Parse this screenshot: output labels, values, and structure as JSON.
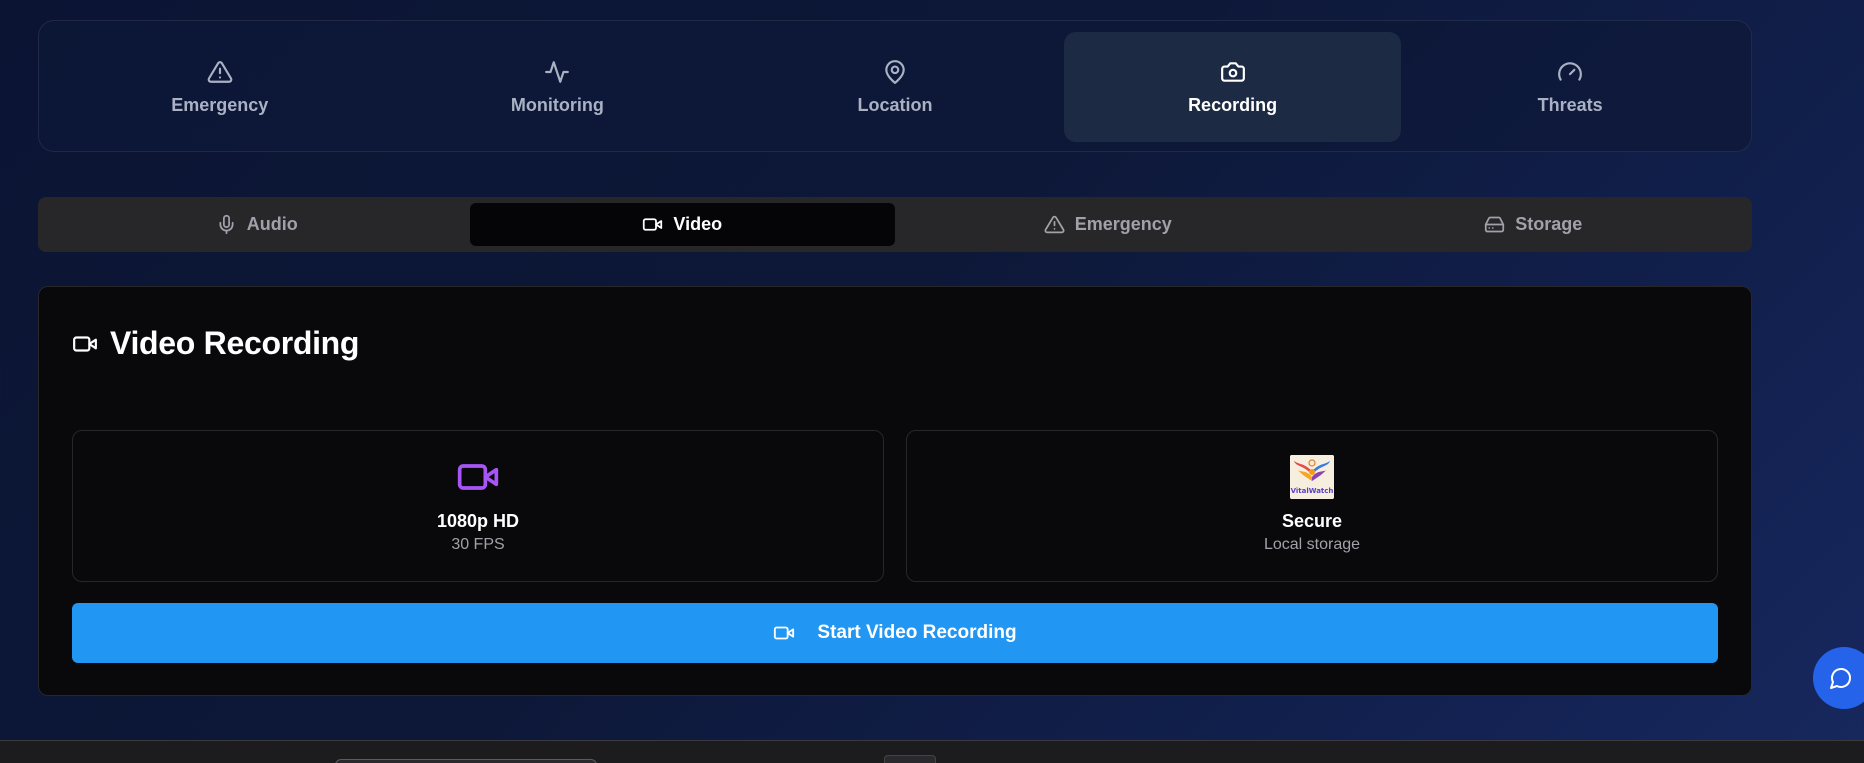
{
  "top_nav": {
    "items": [
      {
        "label": "Emergency",
        "icon": "alert-triangle-icon",
        "active": false
      },
      {
        "label": "Monitoring",
        "icon": "activity-icon",
        "active": false
      },
      {
        "label": "Location",
        "icon": "map-pin-icon",
        "active": false
      },
      {
        "label": "Recording",
        "icon": "camera-icon",
        "active": true
      },
      {
        "label": "Threats",
        "icon": "gauge-icon",
        "active": false
      }
    ]
  },
  "sub_tabs": {
    "items": [
      {
        "label": "Audio",
        "icon": "mic-icon",
        "active": false
      },
      {
        "label": "Video",
        "icon": "video-icon",
        "active": true
      },
      {
        "label": "Emergency",
        "icon": "alert-triangle-icon",
        "active": false
      },
      {
        "label": "Storage",
        "icon": "hard-drive-icon",
        "active": false
      }
    ]
  },
  "card": {
    "title": "Video Recording",
    "icon": "video-icon",
    "features": [
      {
        "title": "1080p HD",
        "subtitle": "30 FPS",
        "icon": "video-icon"
      },
      {
        "title": "Secure",
        "subtitle": "Local storage",
        "icon": "app-logo",
        "logo_text": "VitalWatch"
      }
    ],
    "start_button": {
      "label": "Start Video Recording",
      "icon": "video-icon"
    }
  },
  "chat_button": {
    "icon": "message-circle-icon"
  },
  "colors": {
    "accent_blue": "#2196f3",
    "fab_blue": "#2563eb",
    "feature_icon_purple": "#a855f7",
    "active_nav_bg": "#1d2a44"
  }
}
